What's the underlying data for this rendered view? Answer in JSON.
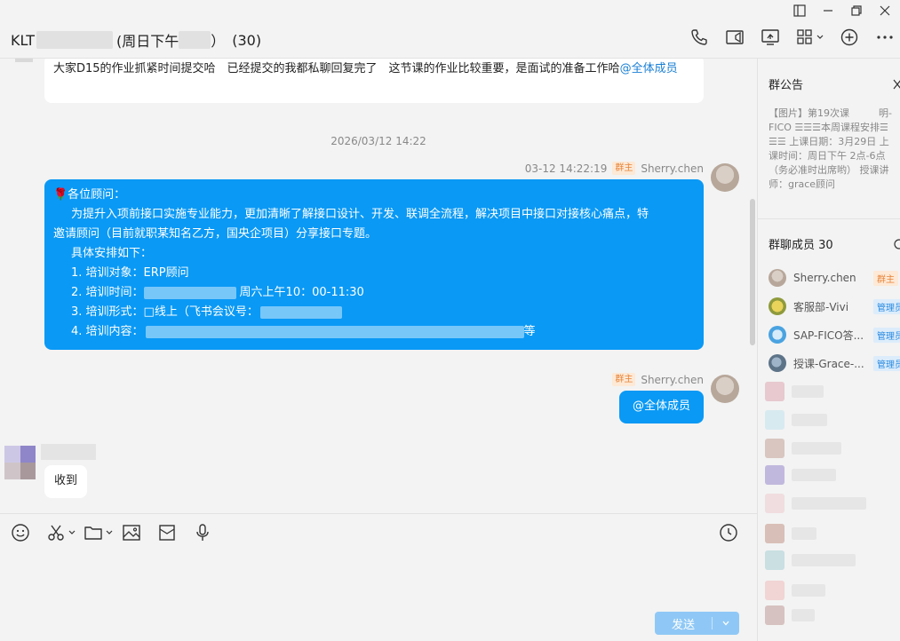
{
  "window": {
    "title_prefix": "KLT",
    "title_middle": "(周日下午",
    "title_end": "）",
    "member_count_label": "(30)"
  },
  "chat": {
    "msg1": {
      "text": "大家D15的作业抓紧时间提交哈　已经提交的我都私聊回复完了　这节课的作业比较重要，是面试的准备工作哈",
      "mention": "@全体成员"
    },
    "timestamp": "2026/03/12 14:22",
    "msg2": {
      "time": "03-12 14:22:19",
      "role": "群主",
      "sender": "Sherry.chen",
      "line1": "🌹各位顾问：",
      "line2": "为提升入项前接口实施专业能力，更加清晰了解接口设计、开发、联调全流程，解决项目中接口对接核心痛点，特",
      "line3": "邀请顾问（目前就职某知名乙方，国央企项目）分享接口专题。",
      "line4": "具体安排如下：",
      "line5": "1. 培训对象：ERP顾问",
      "line6a": "2. 培训时间：",
      "line6b": "周六上午10：00-11:30",
      "line7": "3. 培训形式：□线上（飞书会议号：",
      "line8a": "4. 培训内容：",
      "line8b": "等"
    },
    "msg3": {
      "role": "群主",
      "sender": "Sherry.chen",
      "text": "@全体成员"
    },
    "msg4": {
      "text": "收到"
    }
  },
  "composer": {
    "send_label": "发送"
  },
  "side": {
    "announcement_title": "群公告",
    "announcement_lines": [
      "【图片】第19次课　　　明-",
      "FICO ☰☰☰本周课程安排☰",
      "☰☰ 上课日期：3月29日 上",
      "课时间：周日下午 2点-6点",
      "（务必准时出席哟） 授课讲",
      "师：grace顾问"
    ],
    "members_title": "群聊成员 30",
    "members": [
      {
        "name": "Sherry.chen",
        "role": "群主"
      },
      {
        "name": "客服部-Vivi",
        "role": "管理员"
      },
      {
        "name": "SAP-FICO答...",
        "role": "管理员"
      },
      {
        "name": "授课-Grace-...",
        "role": "管理员"
      }
    ]
  },
  "colors": {
    "accent": "#0a99f5",
    "send_button": "#8fc8f6",
    "owner_tag": "#e7843a",
    "admin_tag": "#2a8be0"
  }
}
